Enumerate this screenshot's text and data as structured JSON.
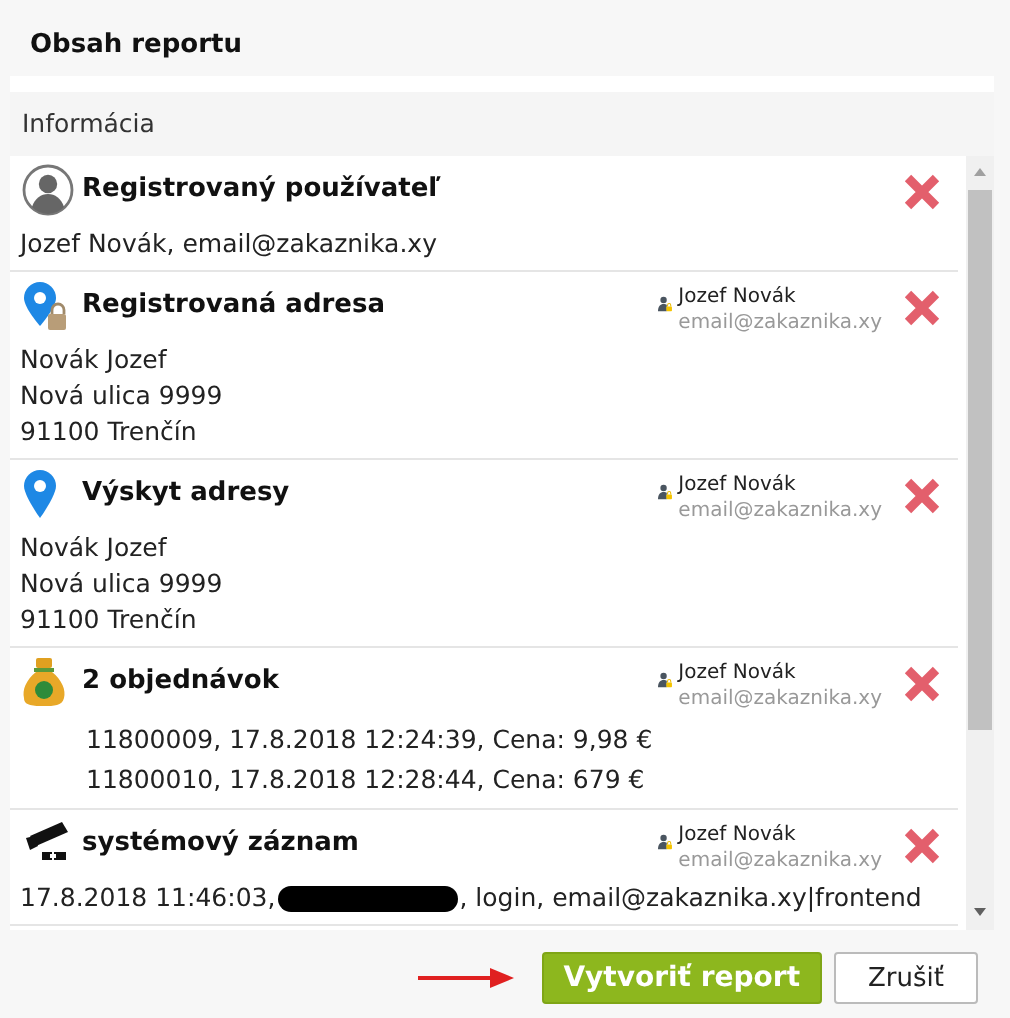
{
  "dialog": {
    "title": "Obsah reportu",
    "section": "Informácia"
  },
  "entries": [
    {
      "kind": "user",
      "title": "Registrovaný používateľ",
      "lines": [
        {
          "kind": "text",
          "text": "Jozef Novák, email@zakaznika.xy"
        }
      ]
    },
    {
      "kind": "address-locked",
      "title": "Registrovaná adresa",
      "owner": {
        "name": "Jozef Novák",
        "email": "email@zakaznika.xy"
      },
      "lines": [
        {
          "kind": "text",
          "text": "Novák Jozef"
        },
        {
          "kind": "text",
          "text": "Nová ulica 9999"
        },
        {
          "kind": "text",
          "text": "91100 Trenčín"
        }
      ]
    },
    {
      "kind": "address",
      "title": "Výskyt adresy",
      "owner": {
        "name": "Jozef Novák",
        "email": "email@zakaznika.xy"
      },
      "lines": [
        {
          "kind": "text",
          "text": "Novák Jozef"
        },
        {
          "kind": "text",
          "text": "Nová ulica 9999"
        },
        {
          "kind": "text",
          "text": "91100 Trenčín"
        }
      ]
    },
    {
      "kind": "orders",
      "title": "2 objednávok",
      "owner": {
        "name": "Jozef Novák",
        "email": "email@zakaznika.xy"
      },
      "lines": [
        {
          "kind": "text",
          "text": "11800009, 17.8.2018 12:24:39, Cena: 9,98 €"
        },
        {
          "kind": "text",
          "text": "11800010, 17.8.2018 12:28:44, Cena: 679 €"
        }
      ]
    },
    {
      "kind": "system",
      "title": "systémový záznam",
      "owner": {
        "name": "Jozef Novák",
        "email": "email@zakaznika.xy"
      },
      "lines": [
        {
          "kind": "redacted",
          "before": "17.8.2018 11:46:03,",
          "after": ", login, email@zakaznika.xy|frontend"
        }
      ]
    }
  ],
  "buttons": [
    {
      "kind": "primary",
      "label": "Vytvoriť report"
    },
    {
      "kind": "secondary",
      "label": "Zrušiť"
    }
  ]
}
